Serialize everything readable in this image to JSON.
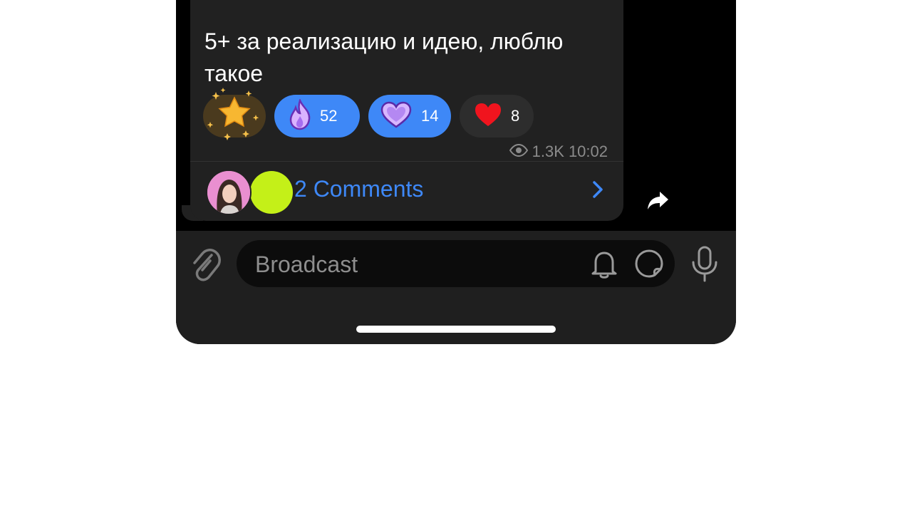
{
  "message": {
    "text": "5+ за реализацию и идею, люблю такое",
    "views": "1.3K",
    "time": "10:02"
  },
  "reactions": [
    {
      "icon": "star-effect-icon",
      "count": ""
    },
    {
      "icon": "fire-icon",
      "count": "52"
    },
    {
      "icon": "purple-heart-icon",
      "count": "14"
    },
    {
      "icon": "red-heart-icon",
      "count": "8"
    }
  ],
  "comments": {
    "label": "2 Comments"
  },
  "input": {
    "placeholder": "Broadcast"
  },
  "colors": {
    "accent": "#3e88f7",
    "bubble": "#212121",
    "background": "#000000"
  }
}
